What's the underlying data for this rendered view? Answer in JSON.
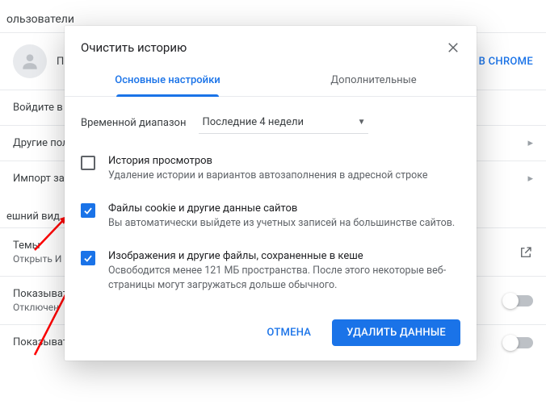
{
  "background": {
    "section_users": "ользователи",
    "profile_name_partial": "П",
    "chrome_link": "В CHROME",
    "sync_text_partial": "Войдите в                                                                                                 а всех устройства",
    "other_users": "Другие пол",
    "import": "Импорт за",
    "appearance": "ешний вид",
    "themes": "Темы",
    "themes_sub": "Открыть И",
    "show1": "Показыват",
    "show1_sub": "Отключен",
    "show2": "Показыват"
  },
  "modal": {
    "title": "Очистить историю",
    "tabs": {
      "basic": "Основные настройки",
      "advanced": "Дополнительные"
    },
    "range_label": "Временной диапазон",
    "range_value": "Последние 4 недели",
    "options": {
      "history": {
        "title": "История просмотров",
        "desc": "Удаление истории и вариантов автозаполнения в адресной строке"
      },
      "cookies": {
        "title": "Файлы cookie и другие данные сайтов",
        "desc": "Вы автоматически выйдете из учетных записей на большинстве сайтов."
      },
      "cache": {
        "title": "Изображения и другие файлы, сохраненные в кеше",
        "desc": "Освободится менее 121 МБ пространства. После этого некоторые веб-страницы могут загружаться дольше обычного."
      }
    },
    "actions": {
      "cancel": "ОТМЕНА",
      "confirm": "УДАЛИТЬ ДАННЫЕ"
    }
  }
}
